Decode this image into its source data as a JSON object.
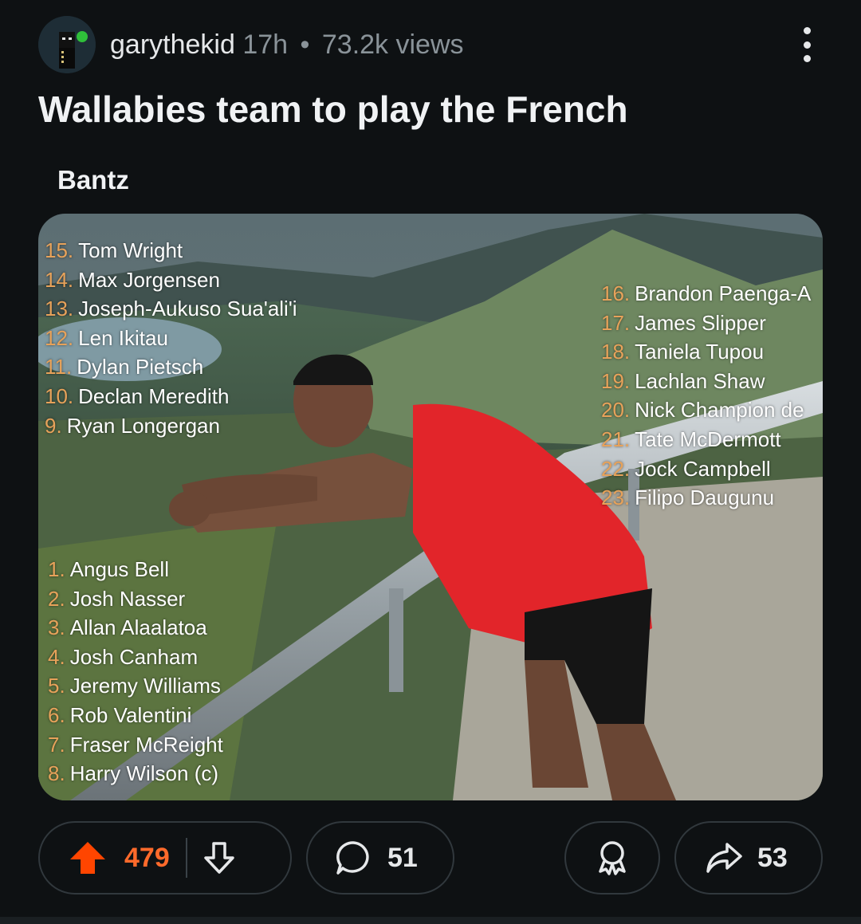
{
  "post": {
    "username": "garythekid",
    "age": "17h",
    "separator": "•",
    "views": "73.2k views",
    "title": "Wallabies team to play the French",
    "flair": "Bantz"
  },
  "image_text": {
    "backs": [
      {
        "num": "15.",
        "name": "Tom Wright"
      },
      {
        "num": "14.",
        "name": "Max Jorgensen"
      },
      {
        "num": "13.",
        "name": "Joseph-Aukuso Sua'ali'i"
      },
      {
        "num": "12.",
        "name": "Len Ikitau"
      },
      {
        "num": "11.",
        "name": "Dylan Pietsch"
      },
      {
        "num": "10.",
        "name": "Declan Meredith"
      },
      {
        "num": "9.",
        "name": "Ryan Longergan"
      }
    ],
    "bench": [
      {
        "num": "16.",
        "name": "Brandon Paenga-A"
      },
      {
        "num": "17.",
        "name": "James Slipper"
      },
      {
        "num": "18.",
        "name": "Taniela Tupou"
      },
      {
        "num": "19.",
        "name": "Lachlan Shaw"
      },
      {
        "num": "20.",
        "name": "Nick Champion de"
      },
      {
        "num": "21.",
        "name": "Tate McDermott"
      },
      {
        "num": "22.",
        "name": "Jock Campbell"
      },
      {
        "num": "23.",
        "name": "Filipo Daugunu"
      }
    ],
    "forwards": [
      {
        "num": "1.",
        "name": "Angus Bell"
      },
      {
        "num": "2.",
        "name": "Josh Nasser"
      },
      {
        "num": "3.",
        "name": "Allan Alaalatoa"
      },
      {
        "num": "4.",
        "name": "Josh Canham"
      },
      {
        "num": "5.",
        "name": "Jeremy Williams"
      },
      {
        "num": "6.",
        "name": "Rob Valentini"
      },
      {
        "num": "7.",
        "name": "Fraser McReight"
      },
      {
        "num": "8.",
        "name": "Harry Wilson (c)"
      }
    ]
  },
  "actions": {
    "upvotes": "479",
    "comments": "51",
    "shares": "53"
  },
  "colors": {
    "background": "#0e1113",
    "upvote_active": "#ff4500",
    "upvote_count": "#ff6a2b",
    "number_accent": "#e7a25a"
  },
  "icons": [
    "avatar",
    "more-options-icon",
    "upvote-arrow-icon",
    "downvote-arrow-icon",
    "comment-bubble-icon",
    "award-icon",
    "share-arrow-icon"
  ]
}
